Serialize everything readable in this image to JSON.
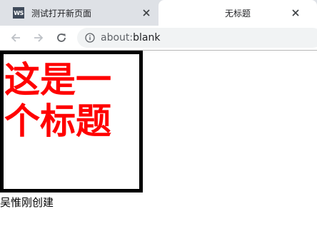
{
  "tabs": [
    {
      "title": "测试打开新页面",
      "favicon": "WS",
      "active": false
    },
    {
      "title": "无标题",
      "active": true
    }
  ],
  "toolbar": {
    "url_scheme": "about:",
    "url_host": "blank"
  },
  "page": {
    "heading": "这是一个标题",
    "caption": "吴惟刚创建",
    "heading_color": "#ff0000",
    "border_color": "#000000"
  },
  "colors": {
    "tabstrip_bg": "#dee1e6",
    "omnibox_bg": "#f1f3f4"
  }
}
